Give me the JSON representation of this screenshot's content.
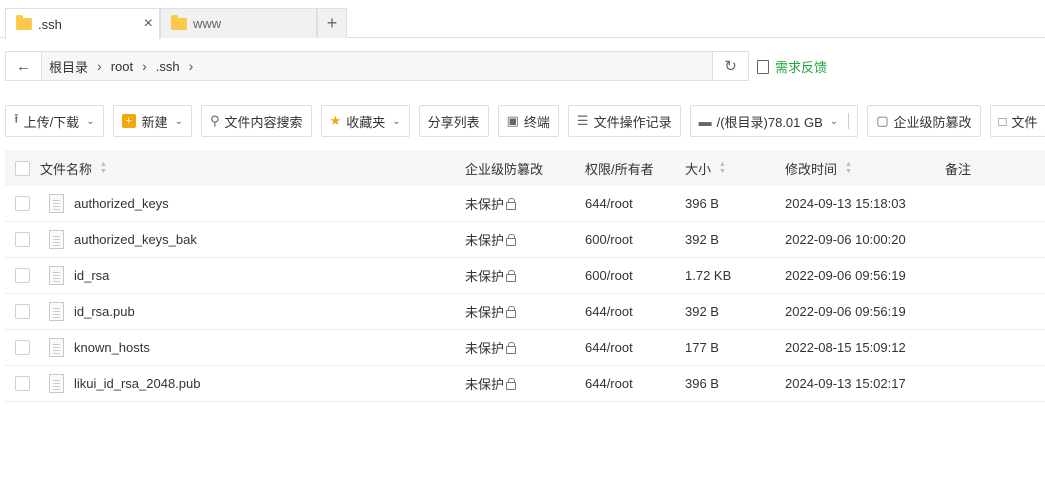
{
  "tabs": [
    {
      "label": ".ssh",
      "active": true
    },
    {
      "label": "www",
      "active": false
    }
  ],
  "tab_add_label": "+",
  "tab_close_label": "×",
  "path": {
    "crumbs": [
      "根目录",
      "root",
      ".ssh"
    ]
  },
  "feedback_label": "需求反馈",
  "toolbar": {
    "upload": "上传/下载",
    "new": "新建",
    "search": "文件内容搜索",
    "favorites": "收藏夹",
    "share": "分享列表",
    "terminal": "终端",
    "oplog": "文件操作记录",
    "disk": "/(根目录)78.01 GB",
    "tamper": "企业级防篡改",
    "more": "文件"
  },
  "table": {
    "headers": {
      "name": "文件名称",
      "protect": "企业级防篡改",
      "perm": "权限/所有者",
      "size": "大小",
      "mtime": "修改时间",
      "note": "备注"
    },
    "rows": [
      {
        "name": "authorized_keys",
        "protect": "未保护",
        "perm": "644/root",
        "size": "396 B",
        "mtime": "2024-09-13 15:18:03"
      },
      {
        "name": "authorized_keys_bak",
        "protect": "未保护",
        "perm": "600/root",
        "size": "392 B",
        "mtime": "2022-09-06 10:00:20"
      },
      {
        "name": "id_rsa",
        "protect": "未保护",
        "perm": "600/root",
        "size": "1.72 KB",
        "mtime": "2022-09-06 09:56:19"
      },
      {
        "name": "id_rsa.pub",
        "protect": "未保护",
        "perm": "644/root",
        "size": "392 B",
        "mtime": "2022-09-06 09:56:19"
      },
      {
        "name": "known_hosts",
        "protect": "未保护",
        "perm": "644/root",
        "size": "177 B",
        "mtime": "2022-08-15 15:09:12"
      },
      {
        "name": "likui_id_rsa_2048.pub",
        "protect": "未保护",
        "perm": "644/root",
        "size": "396 B",
        "mtime": "2024-09-13 15:02:17"
      }
    ]
  },
  "colors": {
    "accent_green": "#20a53a",
    "folder_yellow": "#fbc94b"
  }
}
